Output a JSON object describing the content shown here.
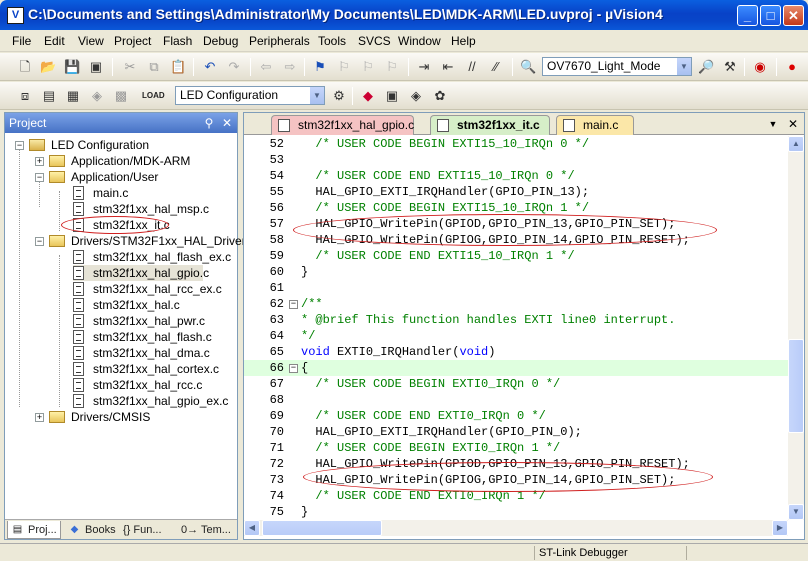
{
  "window": {
    "title": "C:\\Documents and Settings\\Administrator\\My Documents\\LED\\MDK-ARM\\LED.uvproj - µVision4",
    "app_icon_letter": "V"
  },
  "menu": [
    "File",
    "Edit",
    "View",
    "Project",
    "Flash",
    "Debug",
    "Peripherals",
    "Tools",
    "SVCS",
    "Window",
    "Help"
  ],
  "toolbar1": {
    "target_combo": "OV7670_Light_Mode"
  },
  "toolbar2": {
    "config_combo": "LED Configuration",
    "load_label": "LOAD"
  },
  "project_panel": {
    "title": "Project",
    "tree": [
      {
        "label": "LED Configuration",
        "type": "root",
        "expanded": true
      },
      {
        "label": "Application/MDK-ARM",
        "type": "folder",
        "expanded": false
      },
      {
        "label": "Application/User",
        "type": "folder",
        "expanded": true
      },
      {
        "label": "main.c",
        "type": "file"
      },
      {
        "label": "stm32f1xx_hal_msp.c",
        "type": "file"
      },
      {
        "label": "stm32f1xx_it.c",
        "type": "file"
      },
      {
        "label": "Drivers/STM32F1xx_HAL_Driver",
        "type": "folder",
        "expanded": true
      },
      {
        "label": "stm32f1xx_hal_flash_ex.c",
        "type": "file"
      },
      {
        "label": "stm32f1xx_hal_gpio.c",
        "type": "file",
        "selected": true
      },
      {
        "label": "stm32f1xx_hal_rcc_ex.c",
        "type": "file"
      },
      {
        "label": "stm32f1xx_hal.c",
        "type": "file"
      },
      {
        "label": "stm32f1xx_hal_pwr.c",
        "type": "file"
      },
      {
        "label": "stm32f1xx_hal_flash.c",
        "type": "file"
      },
      {
        "label": "stm32f1xx_hal_dma.c",
        "type": "file"
      },
      {
        "label": "stm32f1xx_hal_cortex.c",
        "type": "file"
      },
      {
        "label": "stm32f1xx_hal_rcc.c",
        "type": "file"
      },
      {
        "label": "stm32f1xx_hal_gpio_ex.c",
        "type": "file"
      },
      {
        "label": "Drivers/CMSIS",
        "type": "folder",
        "expanded": false
      }
    ],
    "tabs": [
      "Proj...",
      "Books",
      "{} Fun...",
      "0→ Tem..."
    ]
  },
  "editor": {
    "tabs": [
      "stm32f1xx_hal_gpio.c",
      "stm32f1xx_it.c",
      "main.c"
    ],
    "active_tab": "stm32f1xx_it.c",
    "lines": [
      {
        "n": "52",
        "text": "  /* USER CODE BEGIN EXTI15_10_IRQn 0 */",
        "kind": "cmt"
      },
      {
        "n": "53",
        "text": "",
        "kind": "code"
      },
      {
        "n": "54",
        "text": "  /* USER CODE END EXTI15_10_IRQn 0 */",
        "kind": "cmt"
      },
      {
        "n": "55",
        "text": "  HAL_GPIO_EXTI_IRQHandler(GPIO_PIN_13);",
        "kind": "code"
      },
      {
        "n": "56",
        "text": "  /* USER CODE BEGIN EXTI15_10_IRQn 1 */",
        "kind": "cmt"
      },
      {
        "n": "57",
        "text": "  HAL_GPIO_WritePin(GPIOD,GPIO_PIN_13,GPIO_PIN_SET);",
        "kind": "code"
      },
      {
        "n": "58",
        "text": "  HAL_GPIO_WritePin(GPIOG,GPIO_PIN_14,GPIO_PIN_RESET);",
        "kind": "code"
      },
      {
        "n": "59",
        "text": "  /* USER CODE END EXTI15_10_IRQn 1 */",
        "kind": "cmt"
      },
      {
        "n": "60",
        "text": "}",
        "kind": "code"
      },
      {
        "n": "61",
        "text": "",
        "kind": "code"
      },
      {
        "n": "62",
        "text": "/**",
        "kind": "cmt",
        "fold": "−"
      },
      {
        "n": "63",
        "text": "* @brief This function handles EXTI line0 interrupt.",
        "kind": "cmt"
      },
      {
        "n": "64",
        "text": "*/",
        "kind": "cmt"
      },
      {
        "n": "65",
        "text_kw": "void",
        "text": " EXTI0_IRQHandler(",
        "text_kw2": "void",
        "text_end": ")",
        "kind": "mixed"
      },
      {
        "n": "66",
        "text": "{",
        "kind": "code",
        "fold": "−",
        "highlight": true
      },
      {
        "n": "67",
        "text": "  /* USER CODE BEGIN EXTI0_IRQn 0 */",
        "kind": "cmt"
      },
      {
        "n": "68",
        "text": "",
        "kind": "code"
      },
      {
        "n": "69",
        "text": "  /* USER CODE END EXTI0_IRQn 0 */",
        "kind": "cmt"
      },
      {
        "n": "70",
        "text": "  HAL_GPIO_EXTI_IRQHandler(GPIO_PIN_0);",
        "kind": "code"
      },
      {
        "n": "71",
        "text": "  /* USER CODE BEGIN EXTI0_IRQn 1 */",
        "kind": "cmt"
      },
      {
        "n": "72",
        "text": "  HAL_GPIO_WritePin(GPIOD,GPIO_PIN_13,GPIO_PIN_RESET);",
        "kind": "code"
      },
      {
        "n": "73",
        "text": "  HAL_GPIO_WritePin(GPIOG,GPIO_PIN_14,GPIO_PIN_SET);",
        "kind": "code"
      },
      {
        "n": "74",
        "text": "  /* USER CODE END EXTI0_IRQn 1 */",
        "kind": "cmt"
      },
      {
        "n": "75",
        "text": "}",
        "kind": "code"
      }
    ]
  },
  "status": {
    "debugger": "ST-Link Debugger"
  },
  "colors": {
    "title_blue": "#0842C7",
    "comment_green": "#008000",
    "keyword_blue": "#0000FF",
    "annotation_red": "#D02020"
  }
}
